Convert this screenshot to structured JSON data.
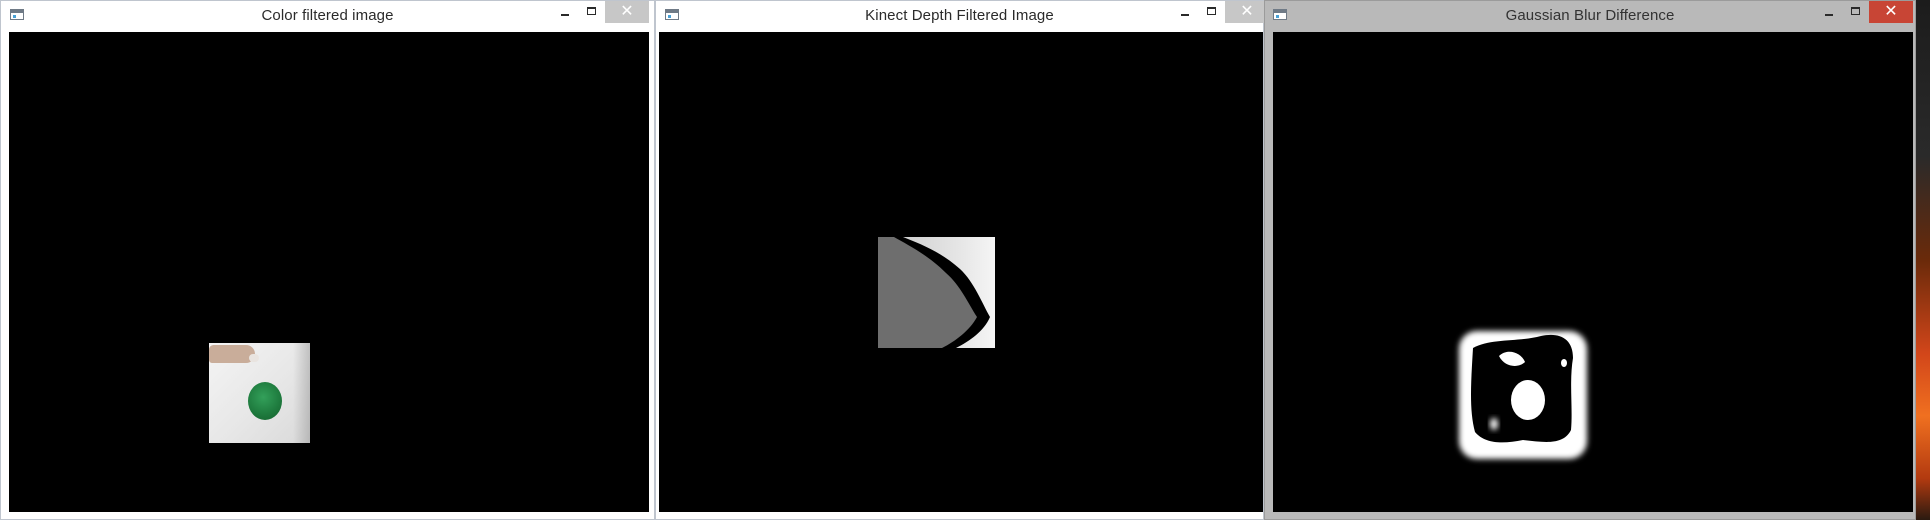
{
  "windows": [
    {
      "title": "Color filtered image",
      "state": "active",
      "canvas_content": "color-filtered-photo"
    },
    {
      "title": "Kinect Depth Filtered Image",
      "state": "active",
      "canvas_content": "depth-map"
    },
    {
      "title": "Gaussian Blur Difference",
      "state": "inactive",
      "canvas_content": "blur-difference"
    }
  ],
  "colors": {
    "canvas_background": "#000000",
    "titlebar_active": "#ffffff",
    "titlebar_inactive": "#b9b9b9",
    "close_inactive": "#c84535",
    "ball_green": "#1f7c3f",
    "depth_gray": "#6e6e6e"
  },
  "icons": [
    "app-icon",
    "minimize-icon",
    "maximize-icon",
    "close-icon"
  ],
  "controls": {
    "close_glyph": "✕"
  }
}
